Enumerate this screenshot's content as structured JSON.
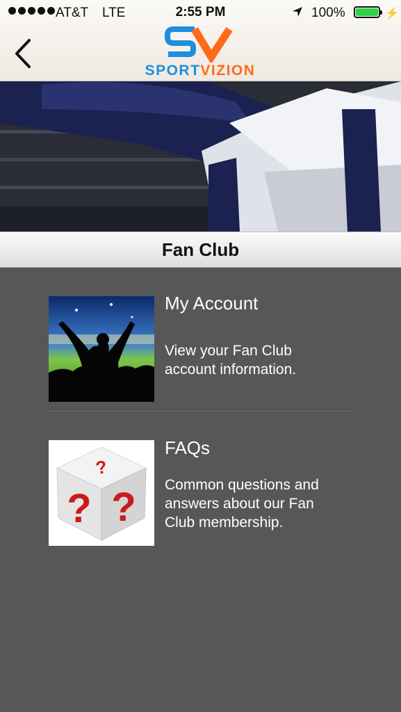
{
  "status_bar": {
    "carrier": "AT&T",
    "network": "LTE",
    "time": "2:55 PM",
    "battery_percent": "100%",
    "battery_level": 1.0,
    "icons": [
      "signal-dots-icon",
      "location-arrow-icon",
      "battery-icon",
      "charging-bolt-icon"
    ]
  },
  "nav": {
    "back_icon": "chevron-left-icon",
    "logo": {
      "monogram": "SV",
      "name_part1": "SPORT",
      "name_part2": "VIZION",
      "colors": {
        "blue": "#1d8ee0",
        "orange": "#ff6a1a"
      }
    }
  },
  "section": {
    "title": "Fan Club"
  },
  "items": [
    {
      "title": "My Account",
      "description_lines": [
        "View your Fan Club",
        "account information."
      ],
      "image": "celebrating-fan-stadium"
    },
    {
      "title": "FAQs",
      "description_lines": [
        "Common questions and",
        "answers about our Fan",
        "Club membership."
      ],
      "image": "question-mark-dice"
    }
  ],
  "colors": {
    "background": "#575757",
    "text": "#ffffff",
    "header": "#f4efe8"
  }
}
